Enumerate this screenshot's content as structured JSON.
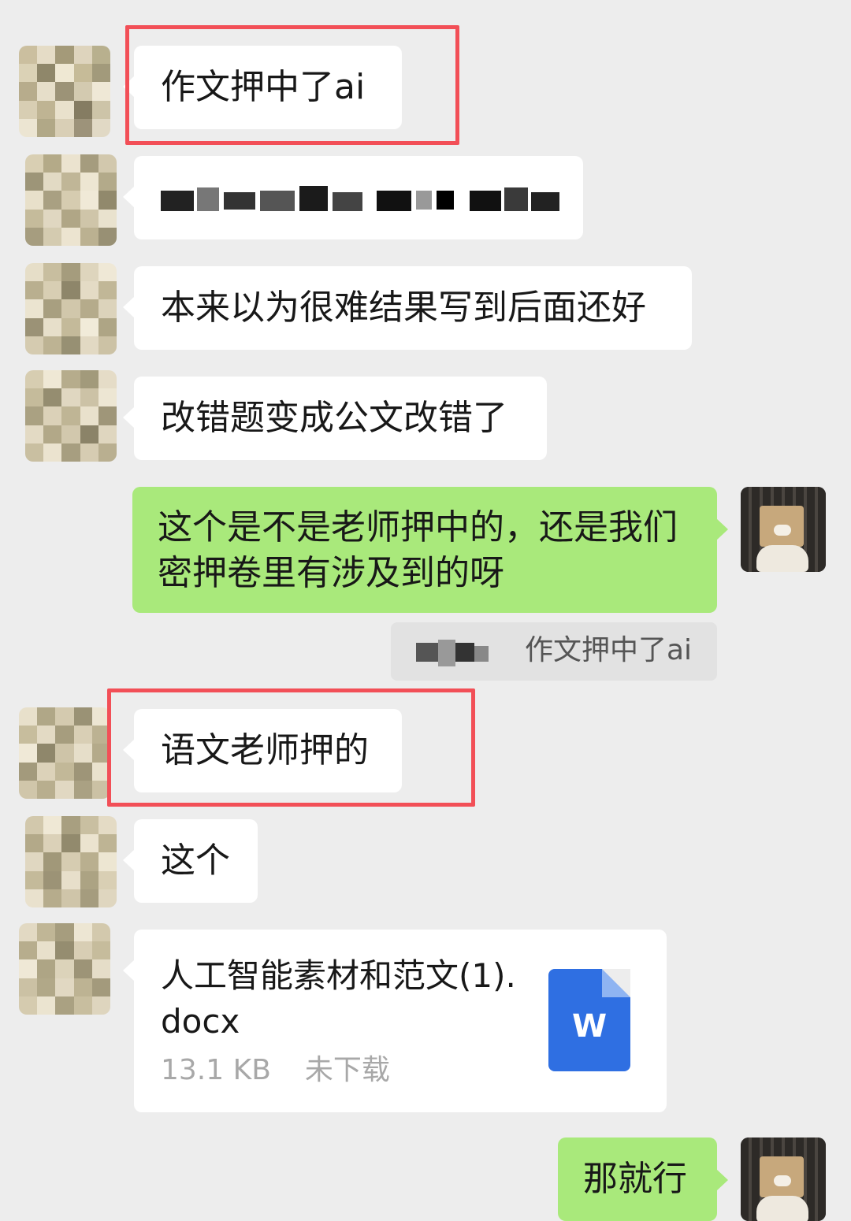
{
  "messages": {
    "m1": "作文押中了ai",
    "m3": "本来以为很难结果写到后面还好",
    "m4": "改错题变成公文改错了",
    "m5": "这个是不是老师押中的，还是我们密押卷里有涉及到的呀",
    "quote_text": "作文押中了ai",
    "m6": "语文老师押的",
    "m7": "这个",
    "m9": "那就行"
  },
  "file": {
    "name": "人工智能素材和范文(1).docx",
    "size": "13.1 KB",
    "status": "未下载",
    "icon_letter": "W"
  },
  "colors": {
    "background": "#ededed",
    "own_bubble": "#a9e97b",
    "other_bubble": "#ffffff",
    "highlight": "#f24f57",
    "word_icon": "#2f6fe2"
  },
  "icons": {
    "file_type": "word-document-icon"
  }
}
